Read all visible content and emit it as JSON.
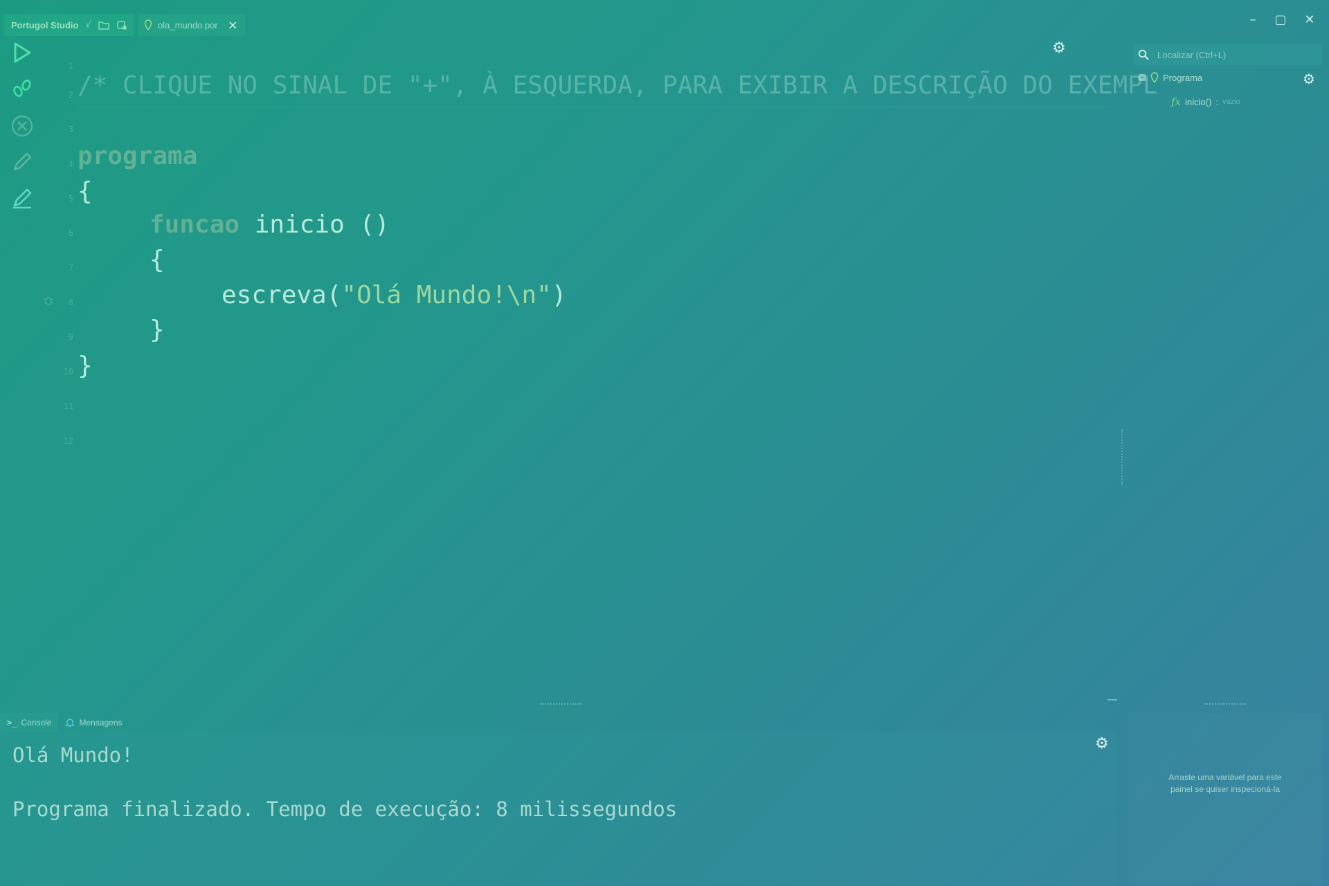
{
  "app": {
    "name": "Portugol Studio",
    "tab_file": "ola_mundo.por"
  },
  "window": {
    "minimize": "–",
    "maximize": "▢",
    "close": "✕"
  },
  "editor": {
    "line_numbers": [
      "1",
      "2",
      "3",
      "4",
      "5",
      "6",
      "7",
      "8",
      "9",
      "10",
      "11",
      "12"
    ],
    "lines": {
      "comment": "/* CLIQUE NO SINAL DE \"+\", À ESQUERDA, PARA EXIBIR A DESCRIÇÃO DO EXEMPL",
      "kw_programa": "programa",
      "open_brace_1": "{",
      "kw_funcao": "funcao",
      "fn_name": " inicio ()",
      "open_brace_2": "{",
      "call_name": "escreva(",
      "call_string": "\"Olá Mundo!\\n\"",
      "call_close": ")",
      "close_brace_2": "}",
      "close_brace_1": "}"
    }
  },
  "outline": {
    "search_placeholder": "Localizar (Ctrl+L)",
    "root_label": "Programa",
    "fn_label": "inicio()",
    "fn_sep": ":",
    "fn_type": "vazio"
  },
  "console": {
    "tabs": [
      {
        "label": "Console"
      },
      {
        "label": "Mensagens"
      }
    ],
    "output_1": "Olá Mundo!",
    "output_2": "Programa finalizado. Tempo de execução: 8 milissegundos"
  },
  "inspector": {
    "hint_line_1": "Arraste uma variável para este",
    "hint_line_2": "painel se quiser inspecioná-la"
  }
}
